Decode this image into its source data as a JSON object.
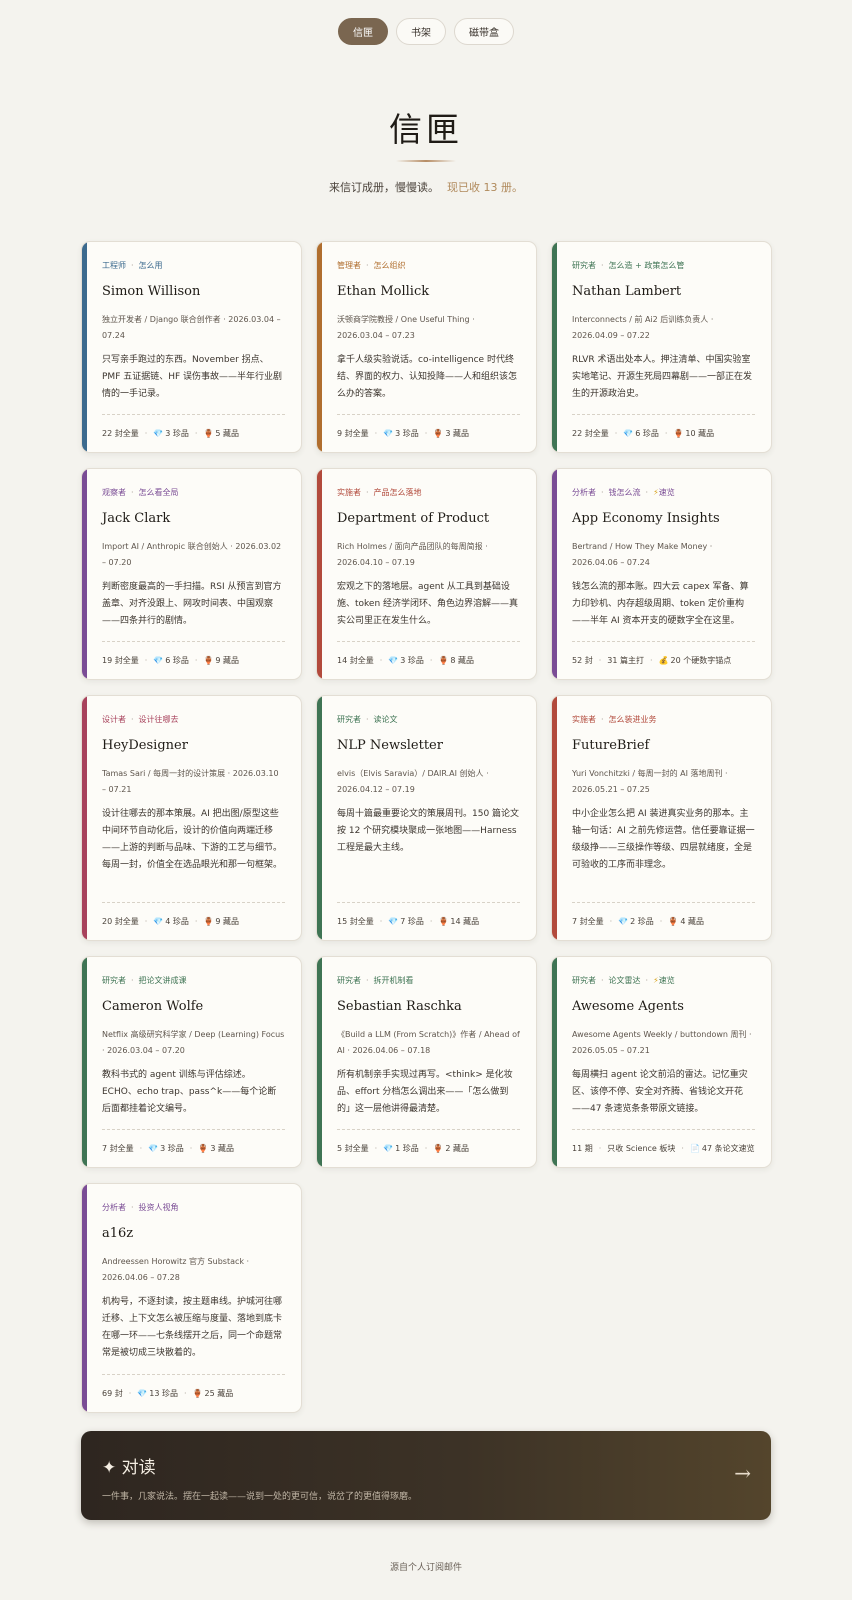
{
  "nav": [
    {
      "label": "信匣",
      "active": true
    },
    {
      "label": "书架",
      "active": false
    },
    {
      "label": "磁带盒",
      "active": false
    }
  ],
  "header": {
    "title": "信匣",
    "subtitle": "来信订成册，慢慢读。",
    "count": "现已收 13 册。"
  },
  "colors": {
    "blue": "#3c6a8e",
    "orange": "#b06e2e",
    "green": "#3f7454",
    "purple": "#7a4c95",
    "red": "#b24a3c",
    "crimson": "#a8425c"
  },
  "cards": [
    {
      "accent": "#3c6a8e",
      "tags": [
        "工程师",
        "怎么用"
      ],
      "name": "Simon Willison",
      "role": "独立开发者 / Django 联合创作者 · 2026.03.04 – 07.24",
      "desc": "只写亲手跑过的东西。November 拐点、PMF 五证据链、HF 误伤事故——半年行业剧情的一手记录。",
      "stats": [
        "22 封全量",
        "3 珍品",
        "5 藏品"
      ]
    },
    {
      "accent": "#b06e2e",
      "tags": [
        "管理者",
        "怎么组织"
      ],
      "name": "Ethan Mollick",
      "role": "沃顿商学院教授 / One Useful Thing · 2026.03.04 – 07.23",
      "desc": "拿千人级实验说话。co-intelligence 时代终结、界面的权力、认知投降——人和组织该怎么办的答案。",
      "stats": [
        "9 封全量",
        "3 珍品",
        "3 藏品"
      ]
    },
    {
      "accent": "#3f7454",
      "tags": [
        "研究者",
        "怎么造 + 政策怎么管"
      ],
      "name": "Nathan Lambert",
      "role": "Interconnects / 前 Ai2 后训练负责人 · 2026.04.09 – 07.22",
      "desc": "RLVR 术语出处本人。押注清单、中国实验室实地笔记、开源生死局四幕剧——一部正在发生的开源政治史。",
      "stats": [
        "22 封全量",
        "6 珍品",
        "10 藏品"
      ]
    },
    {
      "accent": "#7a4c95",
      "tags": [
        "观察者",
        "怎么看全局"
      ],
      "name": "Jack Clark",
      "role": "Import AI / Anthropic 联合创始人 · 2026.03.02 – 07.20",
      "desc": "判断密度最高的一手扫描。RSI 从预言到官方盖章、对齐没跟上、网攻时间表、中国观察——四条并行的剧情。",
      "stats": [
        "19 封全量",
        "6 珍品",
        "9 藏品"
      ]
    },
    {
      "accent": "#b24a3c",
      "tags": [
        "实施者",
        "产品怎么落地"
      ],
      "name": "Department of Product",
      "role": "Rich Holmes / 面向产品团队的每周简报 · 2026.04.10 – 07.19",
      "desc": "宏观之下的落地层。agent 从工具到基础设施、token 经济学闭环、角色边界溶解——真实公司里正在发生什么。",
      "stats": [
        "14 封全量",
        "3 珍品",
        "8 藏品"
      ]
    },
    {
      "accent": "#7a4c95",
      "tags": [
        "分析者",
        "钱怎么流",
        "速览"
      ],
      "name": "App Economy Insights",
      "role": "Bertrand / How They Make Money · 2026.04.06 – 07.24",
      "desc": "钱怎么流的那本账。四大云 capex 军备、算力印钞机、内存超级周期、token 定价重构——半年 AI 资本开支的硬数字全在这里。",
      "stats": [
        "52 封",
        "31 篇主打",
        "20 个硬数字锚点"
      ]
    },
    {
      "accent": "#a8425c",
      "tags": [
        "设计者",
        "设计往哪去"
      ],
      "name": "HeyDesigner",
      "role": "Tamas Sari / 每周一封的设计策展 · 2026.03.10 – 07.21",
      "desc": "设计往哪去的那本策展。AI 把出图/原型这些中间环节自动化后，设计的价值向两端迁移——上游的判断与品味、下游的工艺与细节。每周一封，价值全在选品眼光和那一句框架。",
      "stats": [
        "20 封全量",
        "4 珍品",
        "9 藏品"
      ]
    },
    {
      "accent": "#3f7454",
      "tags": [
        "研究者",
        "读论文"
      ],
      "name": "NLP Newsletter",
      "role": "elvis（Elvis Saravia）/ DAIR.AI 创始人 · 2026.04.12 – 07.19",
      "desc": "每周十篇最重要论文的策展周刊。150 篇论文按 12 个研究模块聚成一张地图——Harness 工程是最大主线。",
      "stats": [
        "15 封全量",
        "7 珍品",
        "14 藏品"
      ]
    },
    {
      "accent": "#b24a3c",
      "tags": [
        "实施者",
        "怎么装进业务"
      ],
      "name": "FutureBrief",
      "role": "Yuri Vonchitzki / 每周一封的 AI 落地周刊 · 2026.05.21 – 07.25",
      "desc": "中小企业怎么把 AI 装进真实业务的那本。主轴一句话：AI 之前先修运营。信任要靠证据一级级挣——三级操作等级、四层就绪度，全是可验收的工序而非理念。",
      "stats": [
        "7 封全量",
        "2 珍品",
        "4 藏品"
      ]
    },
    {
      "accent": "#3f7454",
      "tags": [
        "研究者",
        "把论文讲成课"
      ],
      "name": "Cameron Wolfe",
      "role": "Netflix 高级研究科学家 / Deep (Learning) Focus · 2026.03.04 – 07.20",
      "desc": "教科书式的 agent 训练与评估综述。ECHO、echo trap、pass^k——每个论断后面都挂着论文编号。",
      "stats": [
        "7 封全量",
        "3 珍品",
        "3 藏品"
      ]
    },
    {
      "accent": "#3f7454",
      "tags": [
        "研究者",
        "拆开机制看"
      ],
      "name": "Sebastian Raschka",
      "role": "《Build a LLM (From Scratch)》作者 / Ahead of AI · 2026.04.06 – 07.18",
      "desc": "所有机制亲手实现过再写。<think> 是化妆品、effort 分档怎么调出来——「怎么做到的」这一层他讲得最清楚。",
      "stats": [
        "5 封全量",
        "1 珍品",
        "2 藏品"
      ]
    },
    {
      "accent": "#3f7454",
      "tags": [
        "研究者",
        "论文雷达",
        "速览"
      ],
      "name": "Awesome Agents",
      "role": "Awesome Agents Weekly / buttondown 周刊 · 2026.05.05 – 07.21",
      "desc": "每周横扫 agent 论文前沿的雷达。记忆重灾区、该停不停、安全对齐腾、省钱论文开花——47 条速览条条带原文链接。",
      "stats": [
        "11 期",
        "只收 Science 板块",
        "47 条论文速览"
      ]
    },
    {
      "accent": "#7a4c95",
      "tags": [
        "分析者",
        "投资人视角"
      ],
      "name": "a16z",
      "role": "Andreessen Horowitz 官方 Substack · 2026.04.06 – 07.28",
      "desc": "机构号，不逐封读，按主题串线。护城河往哪迁移、上下文怎么被压缩与度量、落地到底卡在哪一环——七条线摆开之后，同一个命题常常是被切成三块散着的。",
      "stats": [
        "69 封",
        "13 珍品",
        "25 藏品"
      ]
    }
  ],
  "banner": {
    "title": "✦ 对读",
    "subtitle": "一件事，几家说法。摆在一起读——说到一处的更可信，说岔了的更值得琢磨。",
    "arrow": "→"
  },
  "footer": "源自个人订阅邮件"
}
